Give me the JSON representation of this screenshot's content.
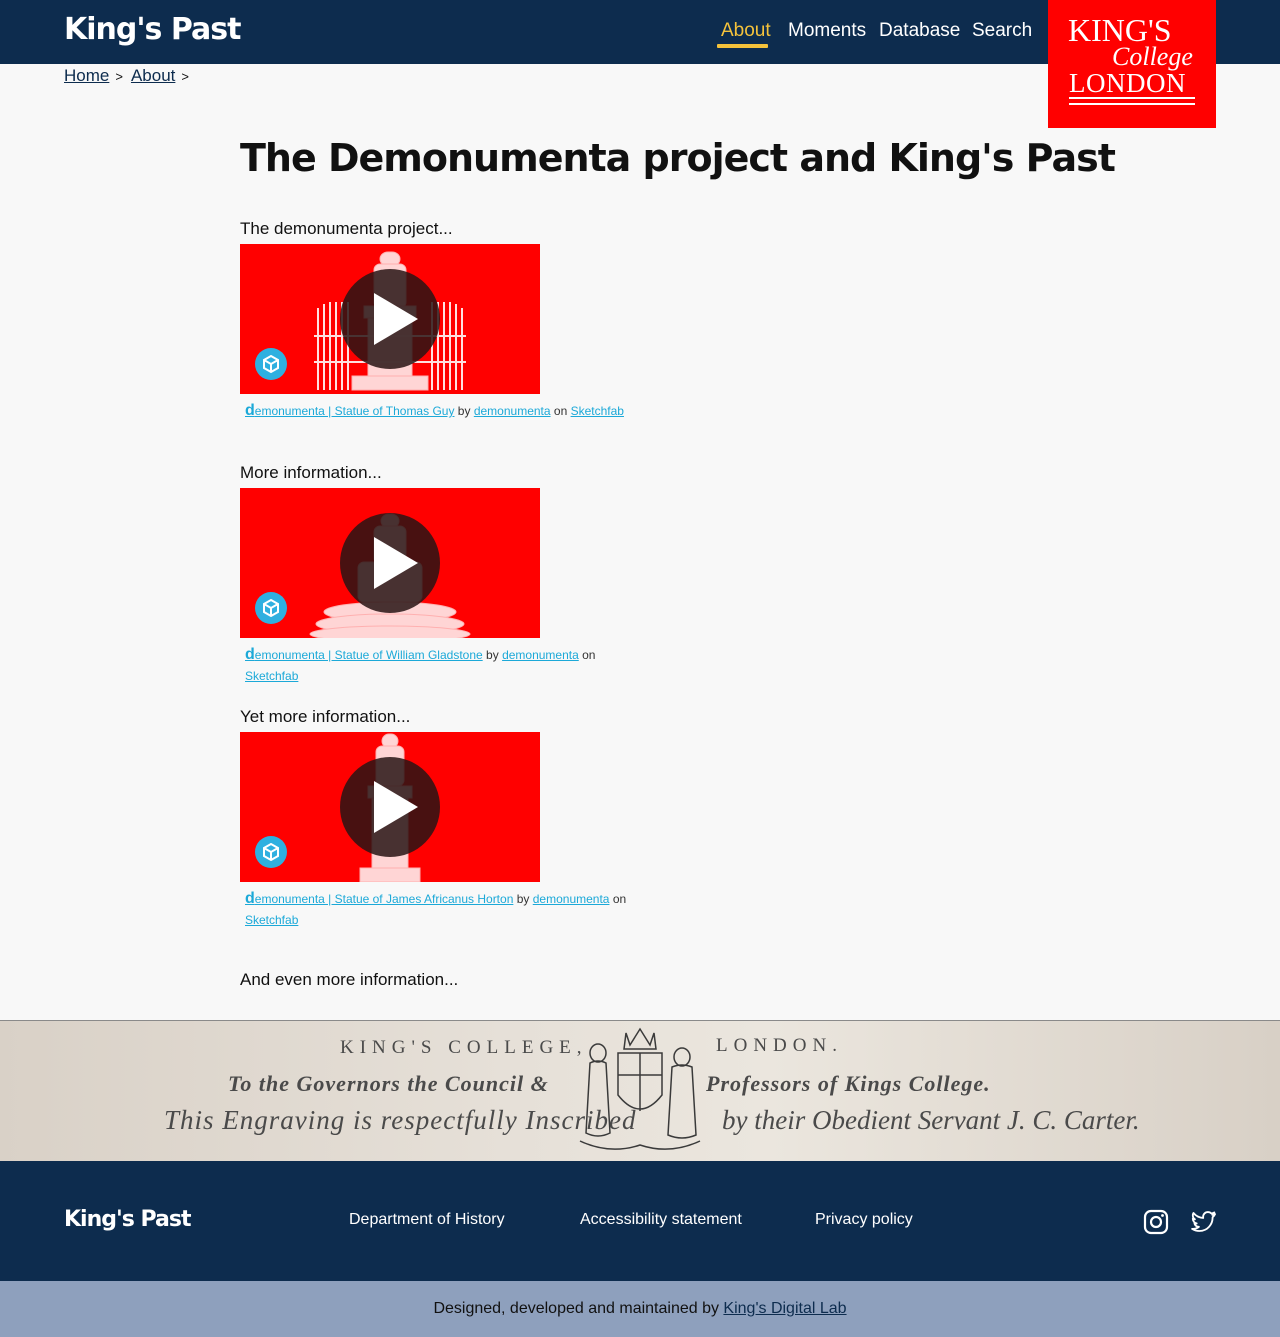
{
  "header": {
    "site_title": "King's Past",
    "nav": [
      {
        "label": "About",
        "active": true
      },
      {
        "label": "Moments",
        "active": false
      },
      {
        "label": "Database",
        "active": false
      },
      {
        "label": "Search",
        "active": false
      }
    ],
    "logo": {
      "line1": "KING'S",
      "line2": "College",
      "line3": "LONDON"
    }
  },
  "breadcrumb": [
    {
      "label": "Home",
      "sep": ">"
    },
    {
      "label": "About",
      "sep": ">"
    }
  ],
  "page_title": "The Demonumenta project and King's Past",
  "sections": [
    {
      "heading": "The demonumenta project...",
      "embed": {
        "d": "d",
        "model_title": "emonumenta | Statue of Thomas Guy",
        "by": "by",
        "author": "demonumenta",
        "on": "on",
        "platform": "Sketchfab"
      }
    },
    {
      "heading": "More information...",
      "embed": {
        "d": "d",
        "model_title": "emonumenta | Statue of William Gladstone",
        "by": "by",
        "author": "demonumenta",
        "on": "on",
        "platform": "Sketchfab"
      }
    },
    {
      "heading": "Yet more information...",
      "embed": {
        "d": "d",
        "model_title": "emonumenta | Statue of James Africanus Horton",
        "by": "by",
        "author": "demonumenta",
        "on": "on",
        "platform": "Sketchfab"
      }
    },
    {
      "heading": "And even more information..."
    }
  ],
  "engraving": {
    "line1a": "KING'S COLLEGE,",
    "line1b": "LONDON.",
    "line2a": "To the Governors the Council &",
    "line2b": "Professors of Kings College.",
    "line3a": "This Engraving is respectfully Inscribed",
    "line3b": "by their Obedient Servant J. C. Carter."
  },
  "footer": {
    "site_title": "King's Past",
    "links": [
      "Department of History",
      "Accessibility statement",
      "Privacy policy"
    ],
    "social": [
      "instagram-icon",
      "twitter-icon"
    ],
    "credit_text": "Designed, developed and maintained by ",
    "credit_link": "King's Digital Lab"
  },
  "colors": {
    "navy": "#0d2c4e",
    "accent": "#f4c23b",
    "kcl_red": "#ff0000",
    "sketchfab_blue": "#1ca9d8",
    "credits_bar": "#8ea0bd"
  }
}
